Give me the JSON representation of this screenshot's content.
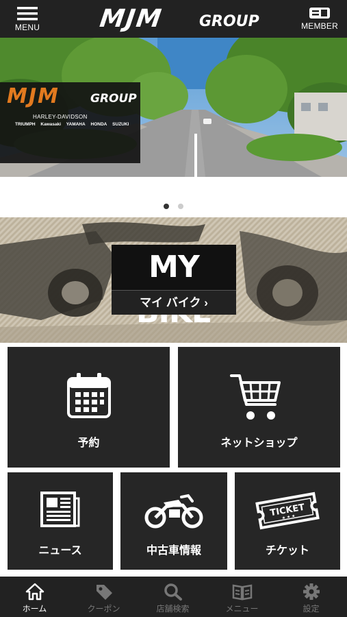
{
  "header": {
    "menu_label": "MENU",
    "member_label": "MEMBER",
    "logo_main": "MJM",
    "logo_sub": "GROUP"
  },
  "hero": {
    "logo_main": "MJM",
    "logo_sub": "GROUP",
    "dealer_line": "HARLEY-DAVIDSON",
    "brands": [
      "TRIUMPH",
      "Kawasaki",
      "YAMAHA",
      "HONDA",
      "SUZUKI"
    ]
  },
  "carousel": {
    "pages": 2,
    "active": 1
  },
  "mybike": {
    "title": "MY BIKE",
    "subtitle": "マイ バイク ›"
  },
  "tiles": {
    "reservation": {
      "label": "予約",
      "icon": "calendar-icon"
    },
    "netshop": {
      "label": "ネットショップ",
      "icon": "shopping-cart-icon"
    },
    "news": {
      "label": "ニュース",
      "icon": "newspaper-icon"
    },
    "used_bikes": {
      "label": "中古車情報",
      "icon": "motorcycle-icon"
    },
    "ticket": {
      "label": "チケット",
      "icon": "ticket-icon",
      "ticket_text": "TICKET"
    }
  },
  "tabbar": {
    "home": "ホーム",
    "coupon": "クーポン",
    "store_search": "店舗検索",
    "menu": "メニュー",
    "settings": "設定",
    "active": "home"
  },
  "colors": {
    "header_bg": "#222222",
    "tile_bg": "#262626",
    "accent_orange": "#e27a1f",
    "tab_inactive": "#777777"
  }
}
